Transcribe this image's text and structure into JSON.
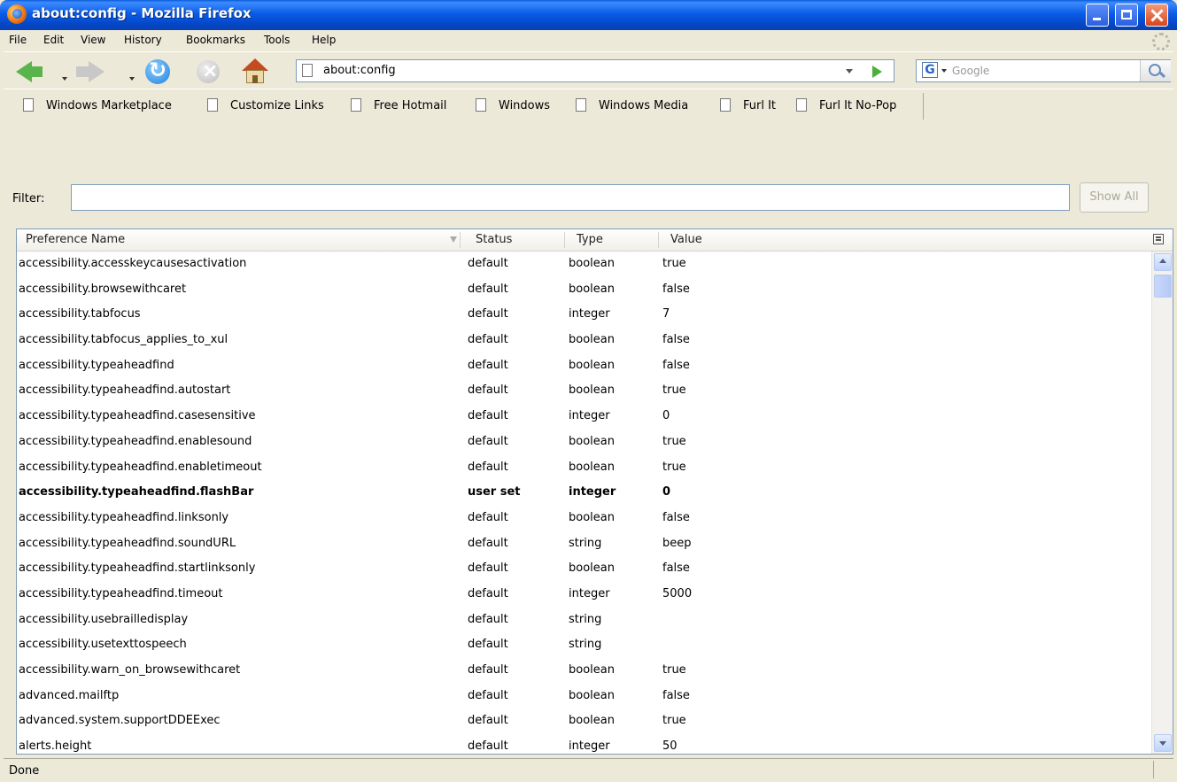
{
  "window": {
    "title": "about:config - Mozilla Firefox"
  },
  "menu": [
    "File",
    "Edit",
    "View",
    "History",
    "Bookmarks",
    "Tools",
    "Help"
  ],
  "nav": {
    "url": "about:config",
    "search_placeholder": "Google",
    "search_engine_letter": "G"
  },
  "bookmarks": [
    "Windows Marketplace",
    "Customize Links",
    "Free Hotmail",
    "Windows",
    "Windows Media",
    "Furl It",
    "Furl It No-Pop"
  ],
  "filter": {
    "label": "Filter:",
    "value": "",
    "show_all": "Show All"
  },
  "columns": {
    "name": "Preference Name",
    "status": "Status",
    "type": "Type",
    "value": "Value"
  },
  "rows": [
    {
      "name": "accessibility.accesskeycausesactivation",
      "status": "default",
      "type": "boolean",
      "value": "true"
    },
    {
      "name": "accessibility.browsewithcaret",
      "status": "default",
      "type": "boolean",
      "value": "false"
    },
    {
      "name": "accessibility.tabfocus",
      "status": "default",
      "type": "integer",
      "value": "7"
    },
    {
      "name": "accessibility.tabfocus_applies_to_xul",
      "status": "default",
      "type": "boolean",
      "value": "false"
    },
    {
      "name": "accessibility.typeaheadfind",
      "status": "default",
      "type": "boolean",
      "value": "false"
    },
    {
      "name": "accessibility.typeaheadfind.autostart",
      "status": "default",
      "type": "boolean",
      "value": "true"
    },
    {
      "name": "accessibility.typeaheadfind.casesensitive",
      "status": "default",
      "type": "integer",
      "value": "0"
    },
    {
      "name": "accessibility.typeaheadfind.enablesound",
      "status": "default",
      "type": "boolean",
      "value": "true"
    },
    {
      "name": "accessibility.typeaheadfind.enabletimeout",
      "status": "default",
      "type": "boolean",
      "value": "true"
    },
    {
      "name": "accessibility.typeaheadfind.flashBar",
      "status": "user set",
      "type": "integer",
      "value": "0",
      "bold": true
    },
    {
      "name": "accessibility.typeaheadfind.linksonly",
      "status": "default",
      "type": "boolean",
      "value": "false"
    },
    {
      "name": "accessibility.typeaheadfind.soundURL",
      "status": "default",
      "type": "string",
      "value": "beep"
    },
    {
      "name": "accessibility.typeaheadfind.startlinksonly",
      "status": "default",
      "type": "boolean",
      "value": "false"
    },
    {
      "name": "accessibility.typeaheadfind.timeout",
      "status": "default",
      "type": "integer",
      "value": "5000"
    },
    {
      "name": "accessibility.usebrailledisplay",
      "status": "default",
      "type": "string",
      "value": ""
    },
    {
      "name": "accessibility.usetexttospeech",
      "status": "default",
      "type": "string",
      "value": ""
    },
    {
      "name": "accessibility.warn_on_browsewithcaret",
      "status": "default",
      "type": "boolean",
      "value": "true"
    },
    {
      "name": "advanced.mailftp",
      "status": "default",
      "type": "boolean",
      "value": "false"
    },
    {
      "name": "advanced.system.supportDDEExec",
      "status": "default",
      "type": "boolean",
      "value": "true"
    },
    {
      "name": "alerts.height",
      "status": "default",
      "type": "integer",
      "value": "50"
    }
  ],
  "status_text": "Done"
}
